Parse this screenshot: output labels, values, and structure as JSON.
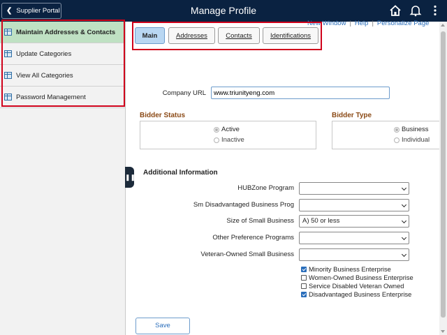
{
  "header": {
    "back_label": "Supplier Portal",
    "title": "Manage Profile"
  },
  "sidebar": {
    "items": [
      {
        "label": "Maintain Addresses & Contacts",
        "active": true
      },
      {
        "label": "Update Categories"
      },
      {
        "label": "View All Categories"
      },
      {
        "label": "Password Management"
      }
    ]
  },
  "links": {
    "new_window": "New Window",
    "help": "Help",
    "personalize": "Personalize Page"
  },
  "tabs": [
    {
      "label": "Main",
      "active": true
    },
    {
      "label": "Addresses"
    },
    {
      "label": "Contacts"
    },
    {
      "label": "Identifications"
    }
  ],
  "form": {
    "company_url_label": "Company URL",
    "company_url_value": "www.triunityeng.com",
    "bidder_status": {
      "title": "Bidder Status",
      "options": [
        {
          "label": "Active",
          "selected": true
        },
        {
          "label": "Inactive",
          "selected": false
        }
      ]
    },
    "bidder_type": {
      "title": "Bidder Type",
      "options": [
        {
          "label": "Business",
          "selected": true
        },
        {
          "label": "Individual",
          "selected": false
        }
      ]
    },
    "additional": {
      "title": "Additional Information",
      "fields": [
        {
          "label": "HUBZone Program",
          "value": ""
        },
        {
          "label": "Sm Disadvantaged Business Prog",
          "value": ""
        },
        {
          "label": "Size of Small Business",
          "value": "A) 50 or less"
        },
        {
          "label": "Other Preference Programs",
          "value": ""
        },
        {
          "label": "Veteran-Owned Small Business",
          "value": ""
        }
      ],
      "checkboxes": [
        {
          "label": "Minority Business Enterprise",
          "checked": true
        },
        {
          "label": "Women-Owned Business Enterprise",
          "checked": false
        },
        {
          "label": "Service Disabled Veteran Owned",
          "checked": false
        },
        {
          "label": "Disadvantaged Business Enterprise",
          "checked": true
        }
      ]
    },
    "save_label": "Save"
  },
  "colors": {
    "header_bg": "#0a2241",
    "active_side_item": "#bfe1c3",
    "active_tab": "#b9d7f2",
    "highlight_box": "#d0021b",
    "section_heading": "#8b4a16",
    "link": "#2a6ebb"
  },
  "icons": [
    "chevron-left-icon",
    "home-icon",
    "bell-icon",
    "more-vertical-icon",
    "list-page-icon"
  ]
}
